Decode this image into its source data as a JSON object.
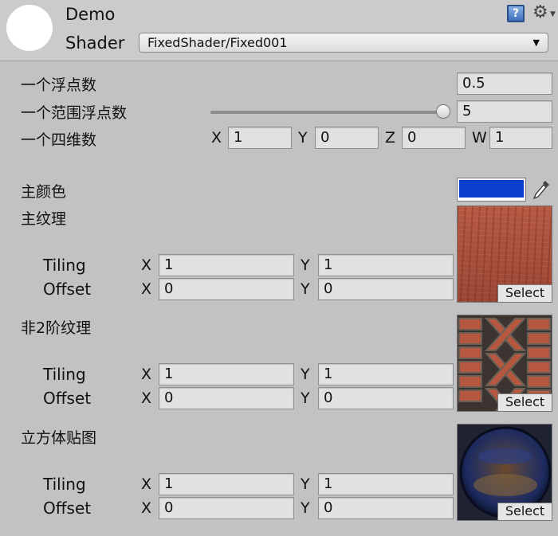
{
  "header": {
    "title": "Demo",
    "shader_label": "Shader",
    "shader_value": "FixedShader/Fixed001",
    "help_icon": "help-book-icon",
    "gear_icon": "gear-icon"
  },
  "props": {
    "float": {
      "label": "一个浮点数",
      "value": "0.5"
    },
    "range": {
      "label": "一个范围浮点数",
      "value": "5",
      "slider_fraction": 1.0
    },
    "vector": {
      "label": "一个四维数",
      "x_label": "X",
      "x": "1",
      "y_label": "Y",
      "y": "0",
      "z_label": "Z",
      "z": "0",
      "w_label": "W",
      "w": "1"
    },
    "color": {
      "label": "主颜色",
      "value": "#0a3fd0",
      "eyedropper_icon": "eyedropper-icon"
    }
  },
  "textures": [
    {
      "label": "主纹理",
      "tiling_label": "Tiling",
      "offset_label": "Offset",
      "x_label": "X",
      "y_label": "Y",
      "tiling_x": "1",
      "tiling_y": "1",
      "offset_x": "0",
      "offset_y": "0",
      "select_label": "Select",
      "thumbnail": "wood-texture"
    },
    {
      "label": "非2阶纹理",
      "tiling_label": "Tiling",
      "offset_label": "Offset",
      "x_label": "X",
      "y_label": "Y",
      "tiling_x": "1",
      "tiling_y": "1",
      "offset_x": "0",
      "offset_y": "0",
      "select_label": "Select",
      "thumbnail": "brick-herringbone-texture"
    },
    {
      "label": "立方体贴图",
      "tiling_label": "Tiling",
      "offset_label": "Offset",
      "x_label": "X",
      "y_label": "Y",
      "tiling_x": "1",
      "tiling_y": "1",
      "offset_x": "0",
      "offset_y": "0",
      "select_label": "Select",
      "thumbnail": "cubemap-sphere-preview"
    }
  ]
}
